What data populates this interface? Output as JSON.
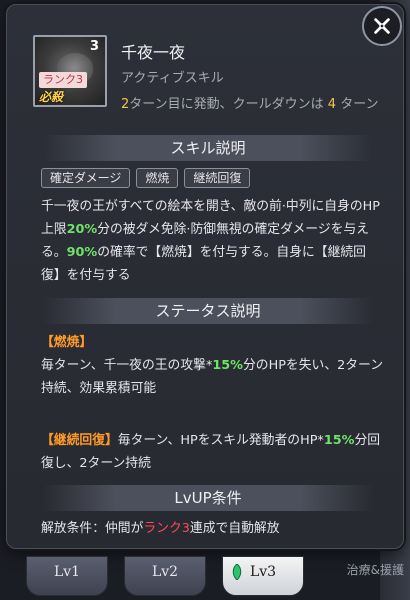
{
  "skill": {
    "name": "千夜一夜",
    "type": "アクティブスキル",
    "icon_level": "3",
    "icon_rank": "ランク3",
    "icon_tag": "必殺",
    "trigger_turn": "2",
    "trigger_text_1": "ターン目に発動、クールダウンは",
    "cooldown": "4",
    "trigger_text_2": "ターン"
  },
  "sections": {
    "skill_desc": "スキル説明",
    "status_desc": "ステータス説明",
    "lvup": "LvUP条件"
  },
  "tags": [
    "確定ダメージ",
    "燃焼",
    "継続回復"
  ],
  "description": {
    "p1": "千一夜の王がすべての絵本を開き、敵の前·中列に自身のHP上限",
    "p1_pct": "20%",
    "p2": "分の被ダメ免除·防御無視の確定ダメージを与える。",
    "p2_pct": "90%",
    "p3": "の確率で【燃焼】を付与する。自身に【継続回復】を付与する"
  },
  "status": {
    "burn_title": "【燃焼】",
    "burn_1": "毎ターン、千一夜の王の攻撃*",
    "burn_pct": "15%",
    "burn_2": "分のHPを失い、2ターン持続、効果累積可能",
    "regen_title": "【継続回復】",
    "regen_1": "毎ターン、HPをスキル発動者のHP*",
    "regen_pct": "15%",
    "regen_2": "分回復し、2ターン持続"
  },
  "lvup": {
    "text_1": "解放条件：仲間が",
    "rank": "ランク3",
    "text_2": "連成で自動解放"
  },
  "tabs": [
    {
      "label": "Lv1",
      "active": false
    },
    {
      "label": "Lv2",
      "active": false
    },
    {
      "label": "Lv3",
      "active": true
    }
  ],
  "background": {
    "right_text": "治療&援護"
  },
  "colors": {
    "highlight_green": "#6fe26a",
    "highlight_yellow": "#f0c64a",
    "highlight_red": "#ff4a58",
    "highlight_orange": "#ff9a2a"
  }
}
